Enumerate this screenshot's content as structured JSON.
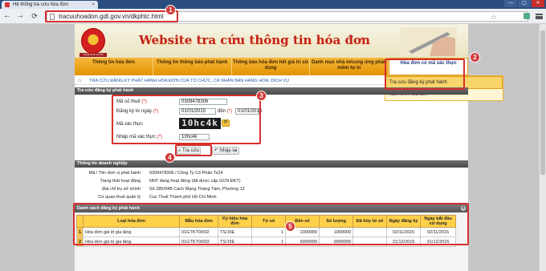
{
  "browser": {
    "tab_title": "Hệ thống tra cứu hóa đơn",
    "url": "tracuuhoadon.gdt.gov.vn/dkphtc.html",
    "win_controls": [
      "—",
      "▢",
      "✕"
    ]
  },
  "banner": {
    "title": "Website tra cứu thông tin hóa đơn",
    "emblem_caption": "THUẾ NHÀ NƯỚC"
  },
  "menu": {
    "items": [
      "Thông tin hóa đơn",
      "Thông tin thông báo phát hành",
      "Thông báo hóa đơn hết giá trị sử dụng",
      "Danh mục nhà in/cung ứng phần mềm tự in",
      "Hóa đơn có mã xác thực"
    ],
    "dropdown": [
      "Tra cứu đăng ký phát hành",
      "Xác minh hóa đơn"
    ]
  },
  "breadcrumb": "TRA CỨU ĐĂNG KÝ PHÁT HÀNH HÓA ĐƠN CỦA TỔ CHỨC, CÁ NHÂN BÁN HÀNG HÓA, DỊCH VỤ",
  "search": {
    "header": "Tra cứu đăng ký phát hành",
    "mst_label": "Mã số thuế",
    "mst_value": "0309478306",
    "from_label": "Đăng ký từ ngày",
    "from_value": "01/01/2015",
    "to_label": "đến",
    "to_value": "01/01/2018",
    "captcha_label": "Mã xác thực",
    "captcha_text": "10hc4k",
    "captcha_input_label": "Nhập mã xác thực",
    "captcha_input_value": "10hc4k",
    "required_mark": "(*)",
    "search_button": "Tra cứu",
    "reset_button": "Nhập lại"
  },
  "company": {
    "header": "Thông tin doanh nghiệp",
    "rows": [
      {
        "label": "Mã / Tên đơn vị phát hành",
        "value": "0309478306 / Công Ty Cổ Phần Ts24"
      },
      {
        "label": "Trạng thái hoạt động",
        "value": "NNT đang hoạt động (đã được cấp GCN ĐKT)"
      },
      {
        "label": "Địa chỉ trụ sở chính",
        "value": "Số 285/94B Cách Mạng Tháng Tám, Phường 12"
      },
      {
        "label": "Cơ quan thuế quản lý",
        "value": "Cục Thuế Thành phố Hồ Chí Minh"
      }
    ]
  },
  "registrations": {
    "header": "Danh sách đăng ký phát hành",
    "columns": [
      "",
      "Loại hóa đơn",
      "Mẫu hóa đơn",
      "Ký hiệu hóa đơn",
      "Từ số",
      "Đến số",
      "Số lượng",
      "Đã hủy từ số",
      "Ngày đăng ký",
      "Ngày bắt đầu sử dụng"
    ],
    "rows": [
      [
        "1",
        "Hóa đơn giá trị gia tăng",
        "01GTKT0/002",
        "TS/15E",
        "1",
        "1000000",
        "1000000",
        "",
        "02/11/2015",
        "02/11/2015"
      ],
      [
        "2",
        "Hóa đơn giá trị gia tăng",
        "01GTKT0/003",
        "TS/15E",
        "1",
        "9999999",
        "9999999",
        "",
        "31/12/2015",
        "31/12/2015"
      ]
    ]
  },
  "annotations": [
    "1",
    "2",
    "3",
    "4",
    "5"
  ],
  "colors": {
    "accent": "#d62f2f",
    "menu": "#f0a51a",
    "link": "#245aa6"
  }
}
